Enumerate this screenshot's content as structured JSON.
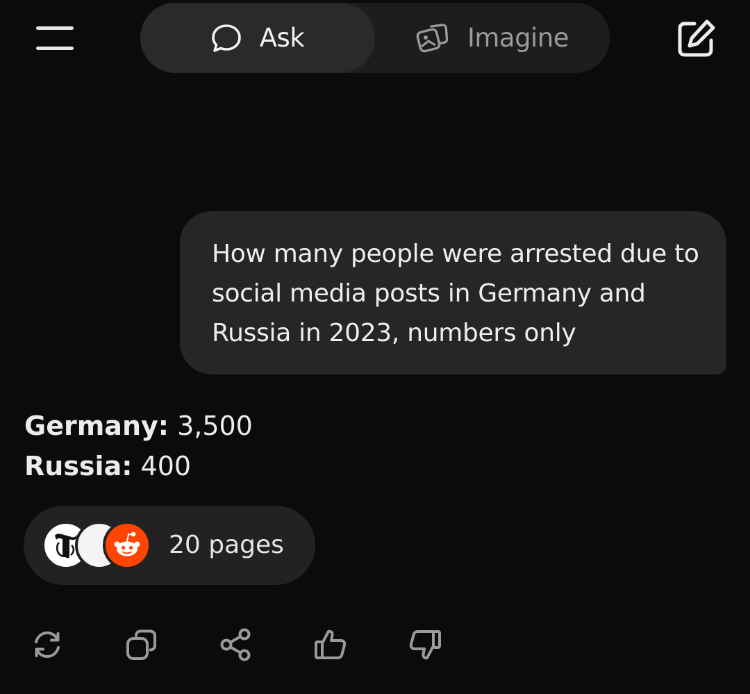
{
  "header": {
    "menu_icon": "menu-icon",
    "compose_icon": "compose-icon",
    "tabs": [
      {
        "label": "Ask",
        "icon": "speech-bubble-icon",
        "active": true
      },
      {
        "label": "Imagine",
        "icon": "image-stack-icon",
        "active": false
      }
    ]
  },
  "conversation": {
    "user_message": "How many people were arrested due to social media posts in Germany and Russia in 2023, numbers only",
    "answer": [
      {
        "key": "Germany:",
        "value": "3,500"
      },
      {
        "key": "Russia:",
        "value": "400"
      }
    ],
    "sources": {
      "label": "20 pages",
      "icons": [
        "nyt-icon",
        "blank-source-icon",
        "reddit-icon"
      ]
    }
  },
  "actions": [
    "regenerate-icon",
    "copy-icon",
    "share-icon",
    "thumbs-up-icon",
    "thumbs-down-icon"
  ],
  "colors": {
    "background": "#0b0b0b",
    "bubble": "#262626",
    "switch_bg": "#1d1d1d",
    "active_tab": "#2a2a2a",
    "reddit": "#ff4500"
  }
}
